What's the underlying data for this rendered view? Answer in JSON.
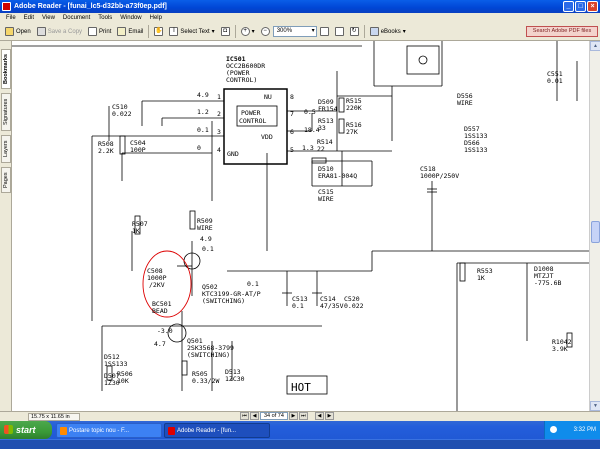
{
  "window": {
    "title": "Adobe Reader - [funai_lc5-d32bb-a73f0ep.pdf]",
    "min": "_",
    "max": "□",
    "close": "×"
  },
  "menu": [
    "File",
    "Edit",
    "View",
    "Document",
    "Tools",
    "Window",
    "Help"
  ],
  "toolbar": {
    "open": "Open",
    "save_copy": "Save a Copy",
    "print": "Print",
    "email": "Email",
    "select_text": "Select Text",
    "zoom": "300%",
    "ebooks": "eBooks",
    "search": "Search Adobe PDF files"
  },
  "side_tabs": [
    "Bookmarks",
    "Signatures",
    "Layers",
    "Pages"
  ],
  "status": {
    "page_size": "15.75 x 11.65 in",
    "page_indicator": "34 of 74"
  },
  "taskbar": {
    "start": "start",
    "items": [
      {
        "label": "Postare topic nou - F...",
        "active": false
      },
      {
        "label": "Adobe Reader - [fun...",
        "active": true
      }
    ],
    "clock": "3:32 PM"
  },
  "schematic": {
    "ic_name": "IC501",
    "ic_part": "OCC2B600DR",
    "ic_func1": "(POWER",
    "ic_func2": "CONTROL)",
    "ic_box1": "POWER",
    "ic_box2": "CONTROL",
    "pins": [
      "1",
      "2",
      "3",
      "4",
      "5",
      "6",
      "7",
      "8"
    ],
    "pin_labels": [
      "NU",
      "VDD",
      "GND"
    ],
    "pin_voltages": [
      "4.9",
      "1.2",
      "0.1",
      "0",
      "1.3",
      "18.4",
      "0.5"
    ],
    "hot": "HOT",
    "labels": [
      "C510",
      "0.022",
      "R508",
      "2.2K",
      "C504",
      "100P",
      "D509",
      "FR154",
      "R515",
      "220K",
      "R513",
      "33",
      "R516",
      "27K",
      "R514",
      "22",
      "D510",
      "ERA81-004Q",
      "C515",
      "WIRE",
      "D556",
      "WIRE",
      "D557",
      "1SS133",
      "D566",
      "1SS133",
      "C551",
      "0.01",
      "C518",
      "1000P/250V",
      "R507",
      "1K",
      "R509",
      "WIRE",
      "4.9",
      "0.1",
      "C508",
      "1000P",
      "/2KV",
      "Q502",
      "KTC3199-GR-AT/P",
      "(SWITCHING)",
      "BC501",
      "BEAD",
      "-3.0",
      "4.7",
      "Q501",
      "2SK3568-3799",
      "(SWITCHING)",
      "D512",
      "1SS133",
      "D507",
      "1Z30",
      "R506",
      "10K",
      "R505",
      "0.33/2W",
      "D513",
      "1ZC30",
      "C513",
      "0.1",
      "C514",
      "47/35V",
      "C520",
      "0.022",
      "R553",
      "1K",
      "D1008",
      "MTZJT",
      "-775.6B",
      "R1042",
      "3.9K",
      "0.1"
    ]
  }
}
